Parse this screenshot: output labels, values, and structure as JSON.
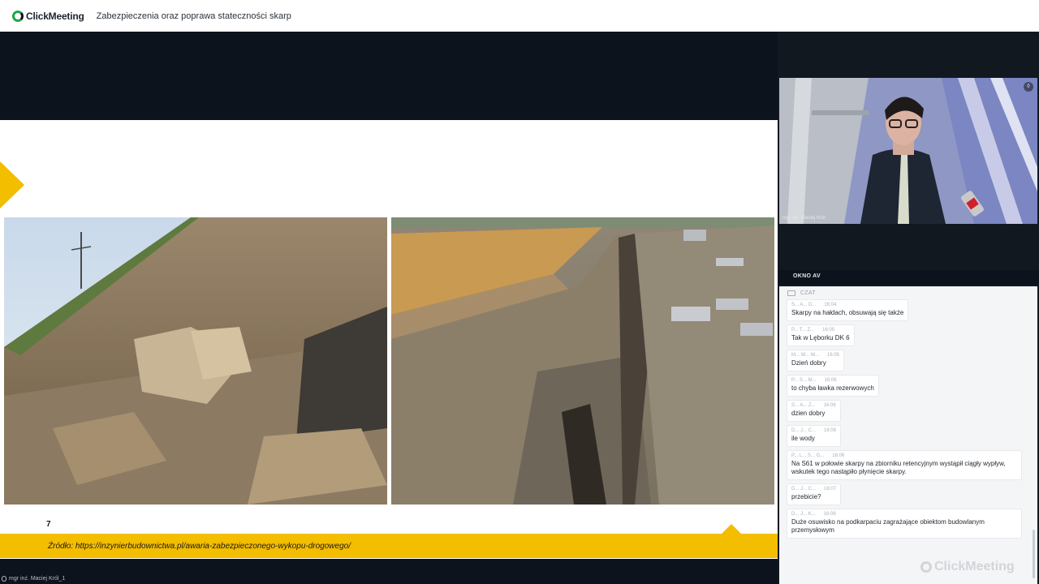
{
  "app": {
    "logo_text": "ClickMeeting",
    "title": "Zabezpieczenia oraz poprawa stateczności skarp",
    "accent": "#f3bd00",
    "brand_green": "#1fa64a"
  },
  "slide": {
    "number": "7",
    "source": "Źródło: https://inzynierbudownictwa.pl/awaria-zabezpieczonego-wykopu-drogowego/"
  },
  "presenter": {
    "tag": "mgr inż. Maciej Król_1",
    "video_label": "mgr inż. Maciej Król"
  },
  "av_panel": {
    "label": "OKNO AV"
  },
  "chat": {
    "title": "CZAT",
    "messages": [
      {
        "author": "S... A... D...",
        "time": "16:04",
        "text": "Skarpy na hałdach, obsuwają się także"
      },
      {
        "author": "P... T... Z...",
        "time": "16:05",
        "text": "Tak  w Lęborku DK 6"
      },
      {
        "author": "M... W... W...",
        "time": "16:05",
        "text": "Dzień dobry"
      },
      {
        "author": "P... S... M...",
        "time": "16:06",
        "text": "to chyba ławka rezerwowych"
      },
      {
        "author": "S... A... Z...",
        "time": "16:06",
        "text": "dzien dobry"
      },
      {
        "author": "D... J... C...",
        "time": "16:06",
        "text": "ile wody"
      },
      {
        "author": "P... L... S... G...",
        "time": "16:06",
        "text": "Na S61 w połowie skarpy na zbiorniku retencyjnym wystąpił ciągły wypływ, wskutek tego nastąpiło płynięcie skarpy."
      },
      {
        "author": "D... J... C...",
        "time": "16:07",
        "text": "przebicie?"
      },
      {
        "author": "D... J... K...",
        "time": "16:08",
        "text": "Duże osuwisko na podkarpaciu zagrażające obiektom budowlanym przemysłowym"
      }
    ],
    "watermark": "ClickMeeting"
  }
}
